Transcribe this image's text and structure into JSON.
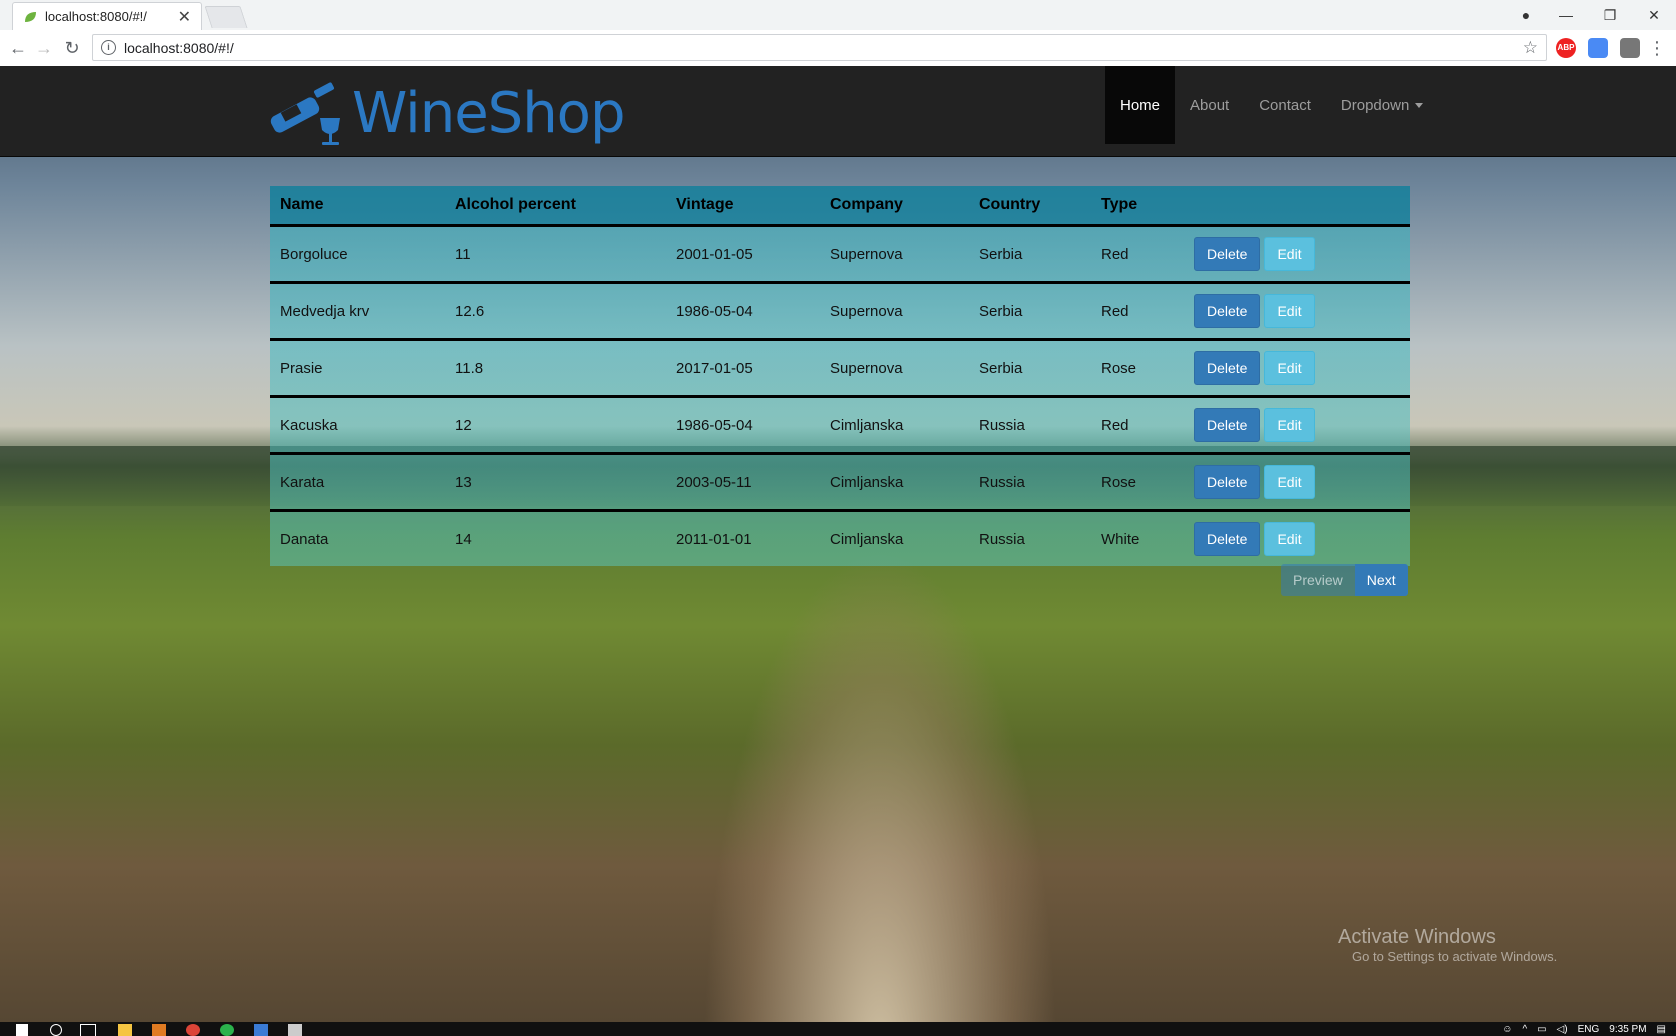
{
  "browser": {
    "tab_title": "localhost:8080/#!/",
    "url": "localhost:8080/#!/",
    "extensions": [
      {
        "name": "adblock-plus-icon",
        "label": "ABP",
        "color": "#e22"
      },
      {
        "name": "translate-extension-icon",
        "label": "",
        "color": "#4a8af4"
      },
      {
        "name": "extension-icon",
        "label": "",
        "color": "#777"
      }
    ]
  },
  "site": {
    "brand": "WineShop",
    "brand_color": "#2b78c2",
    "nav": [
      {
        "label": "Home",
        "active": true
      },
      {
        "label": "About"
      },
      {
        "label": "Contact"
      },
      {
        "label": "Dropdown",
        "has_caret": true
      }
    ]
  },
  "table": {
    "headers": [
      "Name",
      "Alcohol percent",
      "Vintage",
      "Company",
      "Country",
      "Type"
    ],
    "rows": [
      [
        "Borgoluce",
        "11",
        "2001-01-05",
        "Supernova",
        "Serbia",
        "Red"
      ],
      [
        "Medvedja krv",
        "12.6",
        "1986-05-04",
        "Supernova",
        "Serbia",
        "Red"
      ],
      [
        "Prasie",
        "11.8",
        "2017-01-05",
        "Supernova",
        "Serbia",
        "Rose"
      ],
      [
        "Kacuska",
        "12",
        "1986-05-04",
        "Cimljanska",
        "Russia",
        "Red"
      ],
      [
        "Karata",
        "13",
        "2003-05-11",
        "Cimljanska",
        "Russia",
        "Rose"
      ],
      [
        "Danata",
        "14",
        "2011-01-01",
        "Cimljanska",
        "Russia",
        "White"
      ]
    ],
    "delete_label": "Delete",
    "edit_label": "Edit"
  },
  "pager": {
    "prev_label": "Preview",
    "next_label": "Next"
  },
  "watermark": {
    "title": "Activate Windows",
    "subtitle": "Go to Settings to activate Windows."
  },
  "taskbar": {
    "language": "ENG",
    "time": "9:35 PM"
  }
}
